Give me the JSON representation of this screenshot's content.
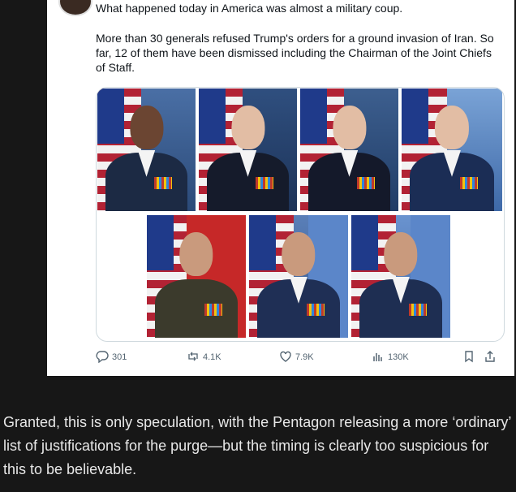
{
  "tweet": {
    "line1": "What happened today in America was almost a military coup.",
    "body": "More than 30 generals refused Trump's orders for a ground invasion of Iran. So far, 12 of them have been dismissed including the Chairman of the Joint Chiefs of Staff."
  },
  "media": {
    "photos": [
      {
        "name": "photo-officer-1"
      },
      {
        "name": "photo-officer-2"
      },
      {
        "name": "photo-officer-3"
      },
      {
        "name": "photo-officer-4"
      },
      {
        "name": "photo-officer-5"
      },
      {
        "name": "photo-officer-6"
      },
      {
        "name": "photo-officer-7"
      }
    ]
  },
  "actions": {
    "replies": "301",
    "reposts": "4.1K",
    "likes": "7.9K",
    "views": "130K"
  },
  "caption": "Granted, this is only speculation, with the Pentagon releasing a more ‘ordinary’ list of justifications for the purge—but the timing is clearly too suspicious for this to be believable.",
  "colors": {
    "page_bg": "#171717",
    "card_bg": "#ffffff",
    "text_dark": "#0f1419",
    "muted": "#536471",
    "caption": "#e8e8e8"
  }
}
